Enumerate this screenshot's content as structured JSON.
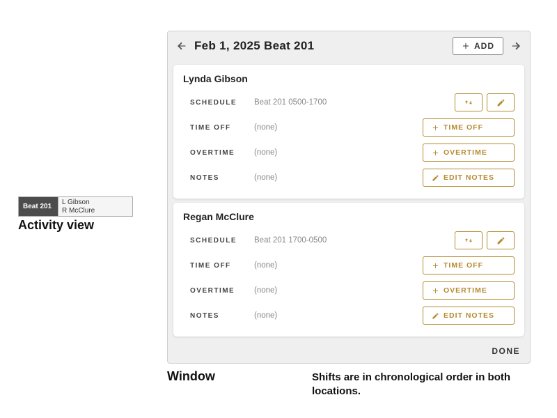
{
  "activity_view": {
    "beat_label": "Beat 201",
    "names": [
      "L Gibson",
      "R McClure"
    ],
    "caption": "Activity view"
  },
  "window": {
    "title": "Feb 1, 2025 Beat 201",
    "add_button": "ADD",
    "done_label": "DONE",
    "labels": {
      "schedule": "SCHEDULE",
      "time_off": "TIME OFF",
      "overtime": "OVERTIME",
      "notes": "NOTES"
    },
    "buttons": {
      "time_off": "TIME OFF",
      "overtime": "OVERTIME",
      "edit_notes": "EDIT NOTES"
    },
    "none_text": "(none)",
    "people": [
      {
        "name": "Lynda Gibson",
        "schedule": "Beat 201 0500-1700",
        "time_off": "(none)",
        "overtime": "(none)",
        "notes": "(none)"
      },
      {
        "name": "Regan McClure",
        "schedule": "Beat 201 1700-0500",
        "time_off": "(none)",
        "overtime": "(none)",
        "notes": "(none)"
      }
    ]
  },
  "captions": {
    "window": "Window",
    "order": "Shifts are in chronological order in both locations."
  },
  "colors": {
    "accent": "#b48a2e"
  }
}
